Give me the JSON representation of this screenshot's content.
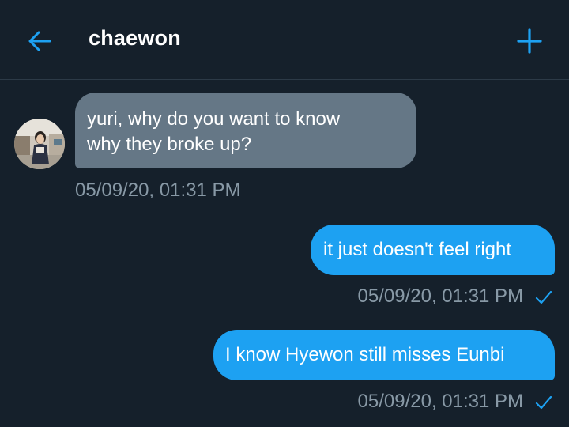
{
  "header": {
    "back_icon": "arrow-left-icon",
    "title": "chaewon",
    "new_icon": "plus-icon"
  },
  "colors": {
    "background": "#15202b",
    "accent": "#1da1f2",
    "incoming_bubble": "#657786",
    "timestamp": "#8899a6"
  },
  "messages": [
    {
      "direction": "incoming",
      "lines": [
        "yuri, why do you want to know",
        "why they broke up?"
      ],
      "timestamp": "05/09/20, 01:31 PM"
    },
    {
      "direction": "outgoing",
      "text": "it just doesn't feel right",
      "timestamp": "05/09/20, 01:31 PM",
      "status_icon": "check-icon"
    },
    {
      "direction": "outgoing",
      "text": "I know Hyewon still misses Eunbi",
      "timestamp": "05/09/20, 01:31 PM",
      "status_icon": "check-icon"
    }
  ]
}
